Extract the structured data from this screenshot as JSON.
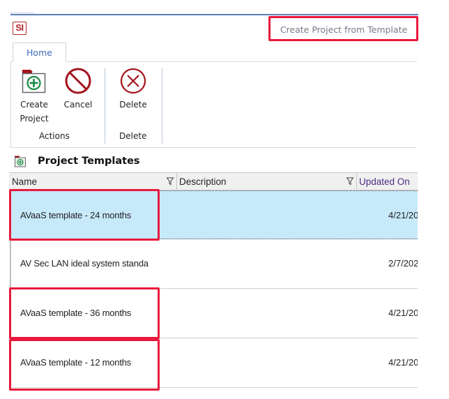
{
  "app": {
    "logo_text": "SI",
    "window_title": "Create Project from Template"
  },
  "ribbon": {
    "tabs": [
      {
        "label": "Home",
        "active": true
      }
    ],
    "groups": [
      {
        "label": "Actions",
        "buttons": [
          {
            "label_line1": "Create",
            "label_line2": "Project",
            "icon": "create-project-icon"
          },
          {
            "label_line1": "Cancel",
            "icon": "cancel-icon"
          }
        ]
      },
      {
        "label": "Delete",
        "buttons": [
          {
            "label_line1": "Delete",
            "icon": "delete-icon"
          }
        ]
      }
    ]
  },
  "section": {
    "title": "Project Templates",
    "icon": "folder-add-icon"
  },
  "grid": {
    "columns": [
      {
        "label": "Name",
        "filterable": true
      },
      {
        "label": "Description",
        "filterable": true
      },
      {
        "label": "Updated On",
        "filterable": false
      }
    ],
    "rows": [
      {
        "name": "AVaaS template - 24 months",
        "description": "",
        "updated_on": "4/21/20",
        "selected": true,
        "highlighted": true
      },
      {
        "name": "AV Sec LAN ideal system standa",
        "description": "",
        "updated_on": "2/7/202",
        "selected": false,
        "highlighted": false
      },
      {
        "name": "AVaaS template - 36 months",
        "description": "",
        "updated_on": "4/21/20",
        "selected": false,
        "highlighted": true
      },
      {
        "name": "AVaaS template - 12 months",
        "description": "",
        "updated_on": "4/21/20",
        "selected": false,
        "highlighted": true
      }
    ]
  },
  "colors": {
    "highlight_box": "#e8193c",
    "selected_row": "#c7eafb",
    "brand_red": "#b3262b",
    "tab_text": "#3b6cb4"
  }
}
